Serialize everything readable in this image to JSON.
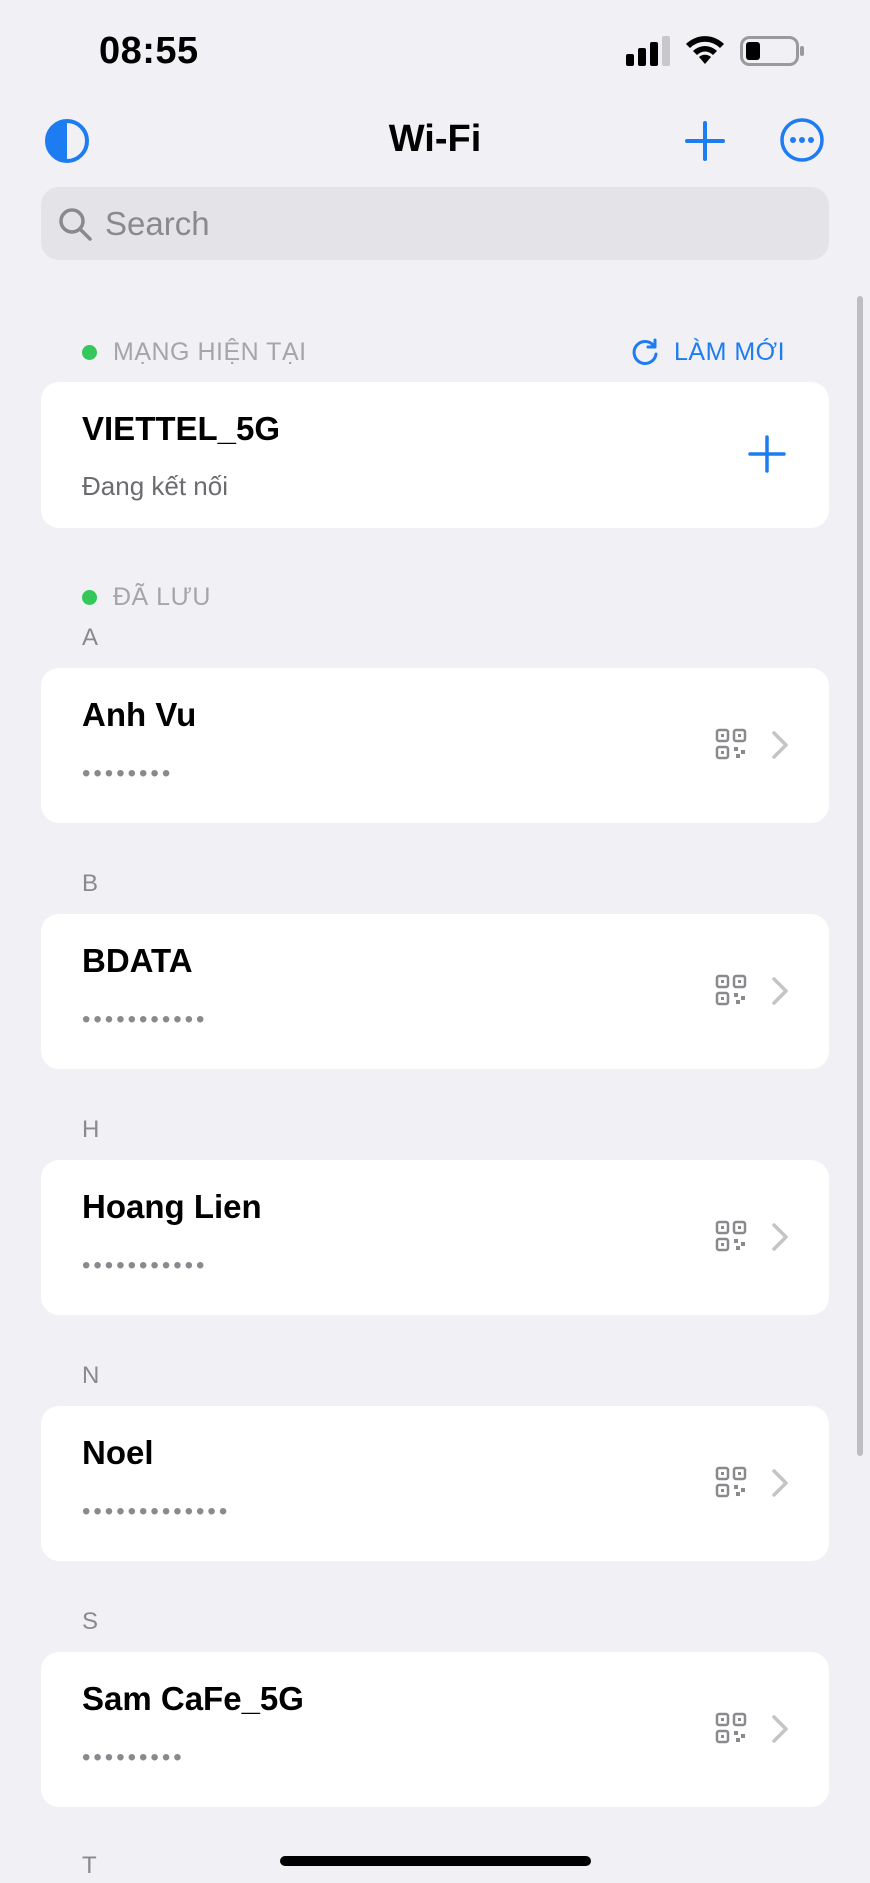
{
  "status_bar": {
    "time": "08:55"
  },
  "nav": {
    "title": "Wi-Fi"
  },
  "search": {
    "placeholder": "Search"
  },
  "current_section": {
    "label": "MẠNG HIỆN TẠI",
    "refresh_label": "LÀM MỚI",
    "network": {
      "name": "VIETTEL_5G",
      "status": "Đang kết nối"
    }
  },
  "saved_section": {
    "label": "ĐÃ LƯU",
    "groups": [
      {
        "letter": "A",
        "name": "Anh Vu",
        "password_mask": "••••••••"
      },
      {
        "letter": "B",
        "name": "BDATA",
        "password_mask": "•••••••••••"
      },
      {
        "letter": "H",
        "name": "Hoang Lien",
        "password_mask": "•••••••••••"
      },
      {
        "letter": "N",
        "name": "Noel",
        "password_mask": "•••••••••••••"
      },
      {
        "letter": "S",
        "name": "Sam CaFe_5G",
        "password_mask": "•••••••••"
      },
      {
        "letter": "T"
      }
    ]
  },
  "colors": {
    "accent": "#1D7CF2",
    "connected_dot": "#34C759",
    "background": "#F0F0F5",
    "card": "#FFFFFF"
  }
}
